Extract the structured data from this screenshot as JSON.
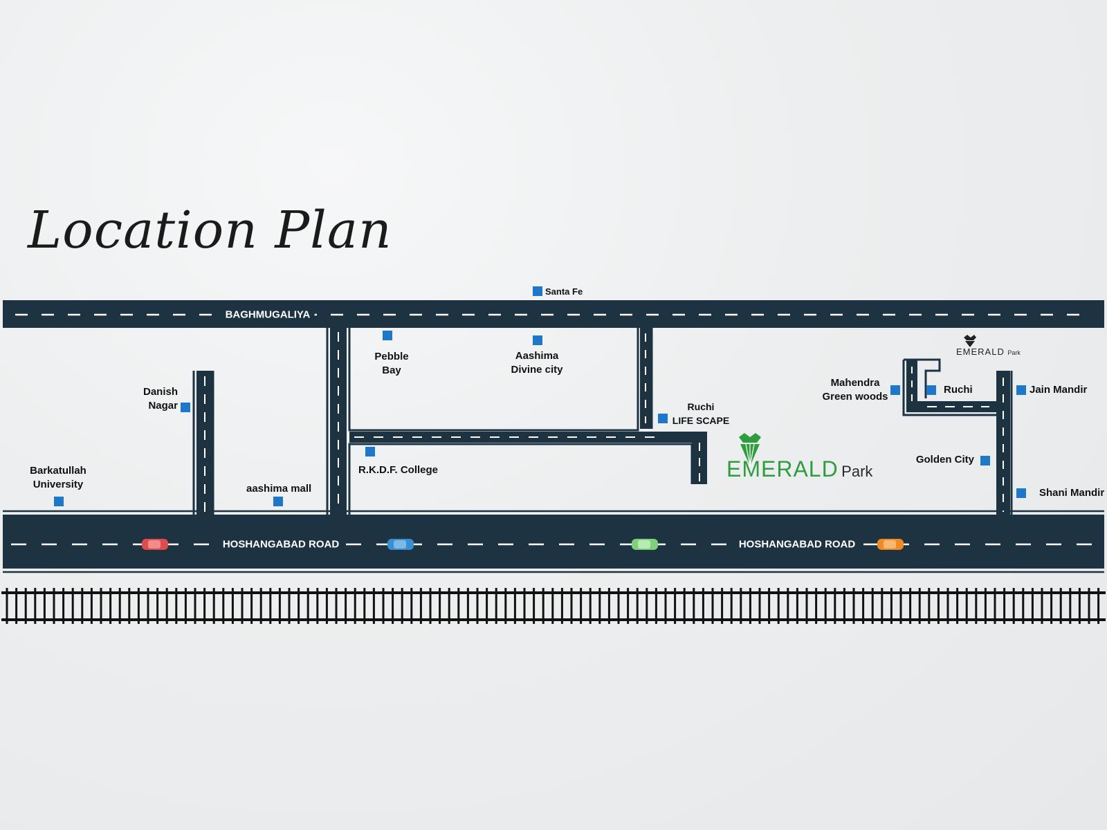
{
  "title": "Location Plan",
  "colors": {
    "road": "#1d3342",
    "lane_dash": "#ffffff",
    "marker": "#1e77c9",
    "brand_green": "#2f9d3e",
    "railway": "#111111",
    "car_red": "#e24b4b",
    "car_blue": "#3a8fd0",
    "car_green": "#7fd07a",
    "car_orange": "#f08a24"
  },
  "roads": {
    "top_name": "BAGHMUGALIYA",
    "bottom_name_1": "HOSHANGABAD ROAD",
    "bottom_name_2": "HOSHANGABAD ROAD"
  },
  "landmarks": {
    "santa_fe": "Santa Fe",
    "pebble_bay": "Pebble\nBay",
    "aashima_divine": "Aashima\nDivine city",
    "danish_nagar": "Danish\nNagar",
    "barkatullah": "Barkatullah\nUniversity",
    "aashima_mall": "aashima mall",
    "rkdf": "R.K.D.F. College",
    "ruchi_lifescape": "Ruchi\nLIFE SCAPE",
    "mahendra": "Mahendra\nGreen woods",
    "ruchi": "Ruchi",
    "jain_mandir": "Jain Mandir",
    "golden_city": "Golden City",
    "shani_mandir": "Shani Mandir"
  },
  "brand": {
    "logo_word": "EMERALD",
    "logo_sub": "Park",
    "small_logo_word": "EMERALD",
    "small_logo_sub": "Park"
  },
  "icons": [
    "location-marker-icon",
    "car-icon",
    "crown-logo-icon",
    "railway-track"
  ]
}
